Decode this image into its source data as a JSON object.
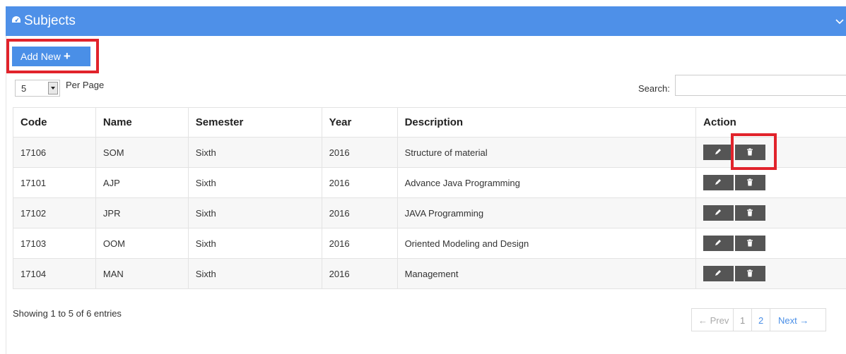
{
  "panel": {
    "title": "Subjects",
    "icon": "dashboard-icon",
    "collapse_icon": "chevron-down-icon",
    "header_color": "#4e90e8"
  },
  "toolbar": {
    "add_label": "Add New",
    "add_icon": "plus-icon"
  },
  "length": {
    "selected": "5",
    "label": "Per Page"
  },
  "search": {
    "label": "Search:",
    "value": ""
  },
  "table": {
    "headers": [
      "Code",
      "Name",
      "Semester",
      "Year",
      "Description",
      "Action"
    ],
    "rows": [
      [
        "17106",
        "SOM",
        "Sixth",
        "2016",
        "Structure of material"
      ],
      [
        "17101",
        "AJP",
        "Sixth",
        "2016",
        "Advance Java Programming"
      ],
      [
        "17102",
        "JPR",
        "Sixth",
        "2016",
        "JAVA Programming"
      ],
      [
        "17103",
        "OOM",
        "Sixth",
        "2016",
        "Oriented Modeling and Design"
      ],
      [
        "17104",
        "MAN",
        "Sixth",
        "2016",
        "Management"
      ]
    ],
    "edit_icon": "pencil-icon",
    "delete_icon": "trash-icon"
  },
  "footer": {
    "info": "Showing 1 to 5 of 6 entries",
    "pagination": {
      "prev": "← Prev",
      "pages": [
        "1",
        "2"
      ],
      "current": "1",
      "next": "Next →"
    }
  },
  "colors": {
    "accent": "#4a8fe7",
    "highlight": "#e1232b",
    "action_button": "#555555"
  }
}
